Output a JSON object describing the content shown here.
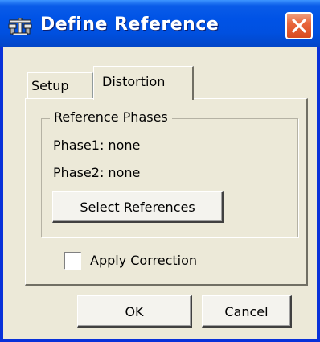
{
  "window": {
    "title": "Define Reference",
    "title_icon": "scale-balance-icon",
    "close_icon": "close-icon"
  },
  "tabs": [
    {
      "label": "Setup",
      "selected": false
    },
    {
      "label": "Distortion",
      "selected": true
    }
  ],
  "reference_group": {
    "label": "Reference Phases",
    "phase1": "Phase1: none",
    "phase2": "Phase2: none",
    "select_button": "Select References"
  },
  "apply_correction": {
    "label": "Apply Correction",
    "checked": false
  },
  "footer": {
    "ok_label": "OK",
    "cancel_label": "Cancel"
  },
  "colors": {
    "titlebar": "#0053e6",
    "dialog_bg": "#ece9d8",
    "close_button": "#e8663c"
  }
}
